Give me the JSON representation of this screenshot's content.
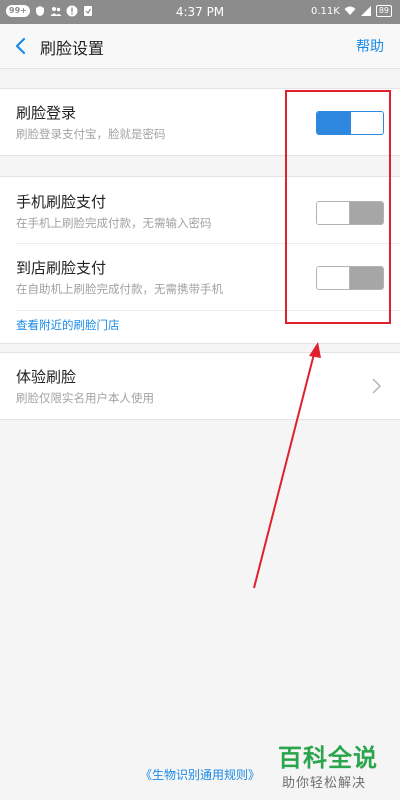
{
  "status_bar": {
    "notification_badge": "99+",
    "time": "4:37 PM",
    "network_speed": "0.11K",
    "battery": "89"
  },
  "header": {
    "title": "刷脸设置",
    "help_label": "帮助"
  },
  "face_login": {
    "title": "刷脸登录",
    "subtitle": "刷脸登录支付宝，脸就是密码",
    "enabled": true
  },
  "phone_face_pay": {
    "title": "手机刷脸支付",
    "subtitle": "在手机上刷脸完成付款，无需输入密码",
    "enabled": false
  },
  "store_face_pay": {
    "title": "到店刷脸支付",
    "subtitle": "在自助机上刷脸完成付款，无需携带手机",
    "enabled": false
  },
  "nearby_link": "查看附近的刷脸门店",
  "try_face": {
    "title": "体验刷脸",
    "subtitle": "刷脸仅限实名用户本人使用"
  },
  "footer_link": "《生物识别通用规则》",
  "watermark": {
    "title": "百科全说",
    "subtitle": "助你轻松解决"
  },
  "colors": {
    "accent": "#2e88e0",
    "annotation": "#e0212d",
    "watermark": "#2aa54c"
  }
}
